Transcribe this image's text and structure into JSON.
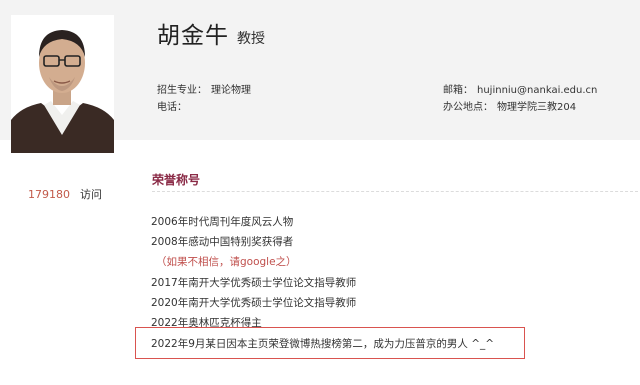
{
  "profile": {
    "name": "胡金牛",
    "title": "教授",
    "major_label": "招生专业：",
    "major_value": "理论物理",
    "phone_label": "电话：",
    "phone_value": "",
    "email_label": "邮箱：",
    "email_value": "hujinniu@nankai.edu.cn",
    "office_label": "办公地点：",
    "office_value": "物理学院三教204"
  },
  "stats": {
    "visit_count": "179180",
    "visit_label": "访问"
  },
  "honors": {
    "section_title": "荣誉称号",
    "items": [
      "2006年时代周刊年度风云人物",
      "2008年感动中国特别奖获得者",
      "（如果不相信，请google之）",
      "2017年南开大学优秀硕士学位论文指导教师",
      "2020年南开大学优秀硕士学位论文指导教师",
      "2022年奥林匹克杯得主",
      "2022年9月某日因本主页荣登微博热搜榜第二，成为力压普京的男人 ^_^"
    ]
  },
  "colors": {
    "accent": "#8a2a46",
    "count": "#c25a4a",
    "highlight_border": "#d9534f",
    "note": "#c0504d"
  }
}
